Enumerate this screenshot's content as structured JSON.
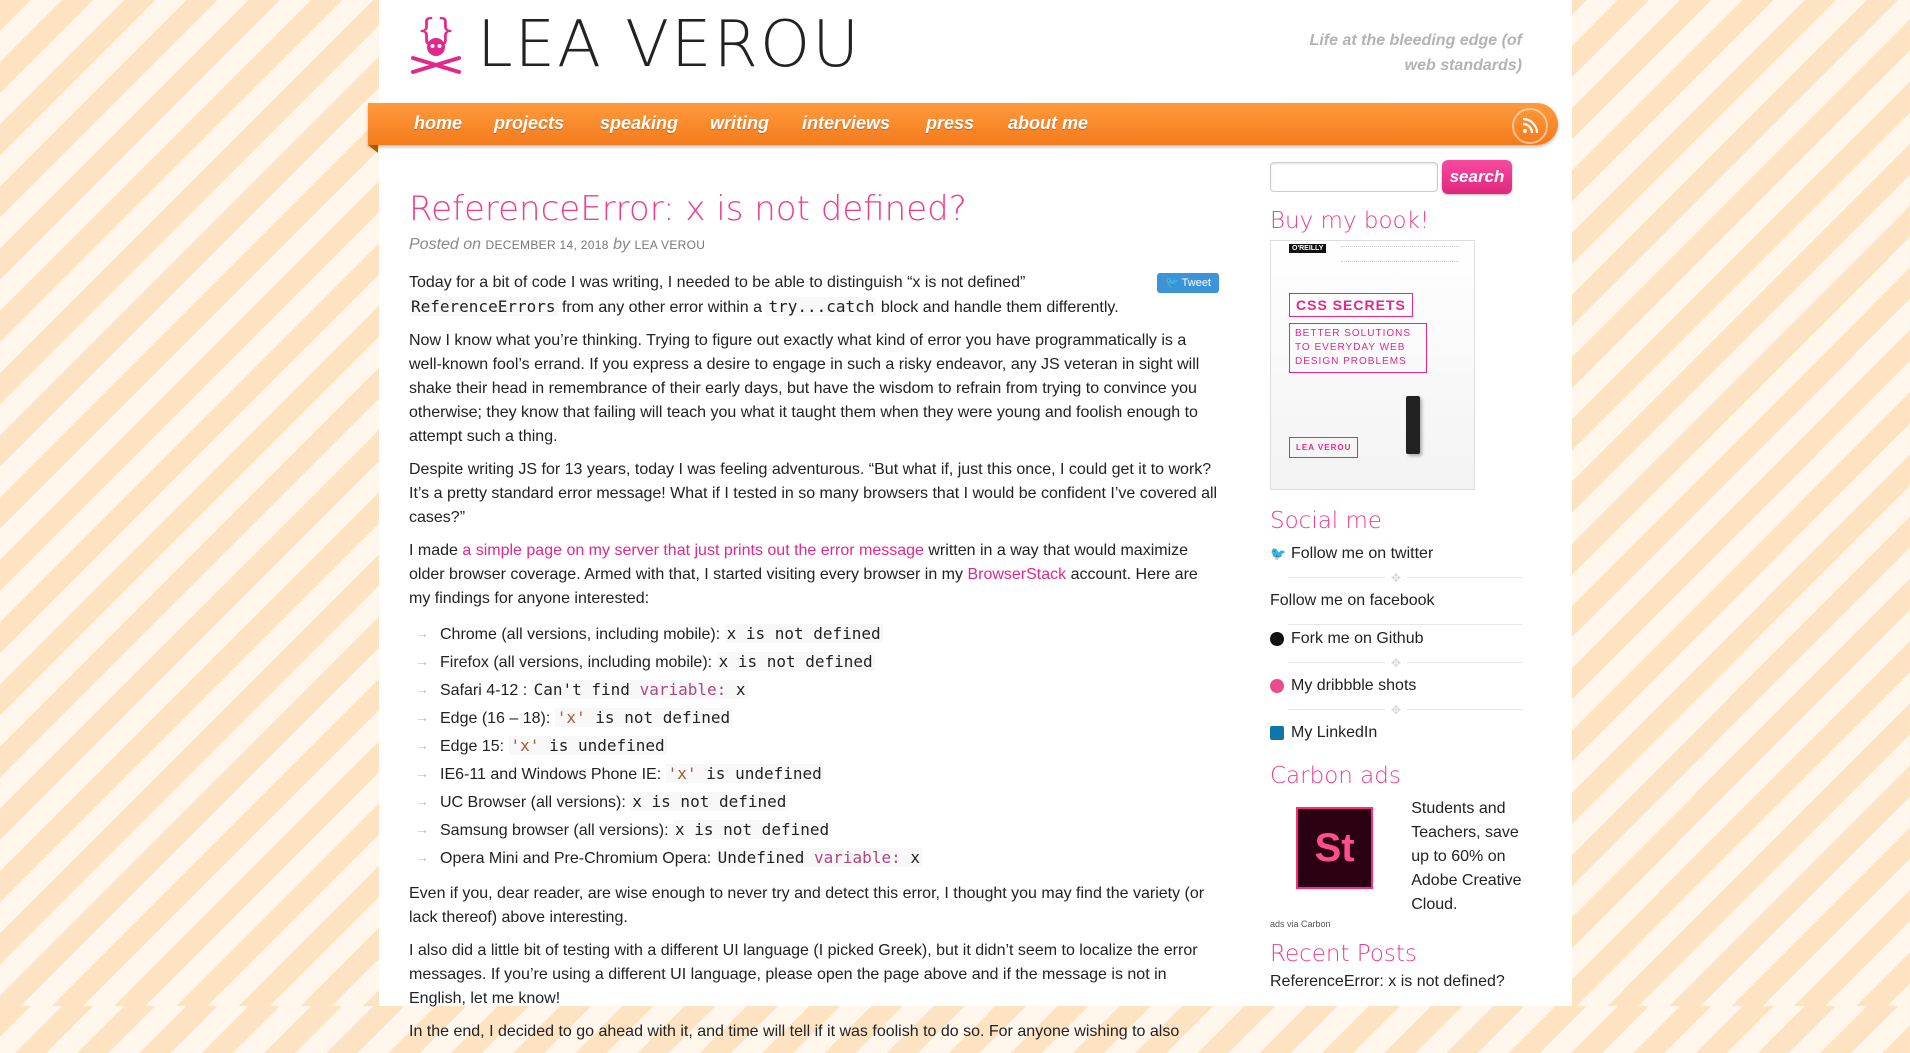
{
  "header": {
    "site_name": "LEA VEROU",
    "tagline": "Life at the bleeding edge (of web standards)"
  },
  "nav": {
    "items": [
      "home",
      "projects",
      "speaking",
      "writing",
      "interviews",
      "press",
      "about me"
    ]
  },
  "post": {
    "title": "ReferenceError: x is not defined?",
    "posted_on": "Posted on",
    "date": "December 14, 2018",
    "by": "by",
    "author": "Lea Verou",
    "tweet": "Tweet",
    "p1": {
      "a": "Today for a bit of code I was writing, I needed to be able to distinguish “x is not defined”",
      "code1": "ReferenceErrors",
      "b": "from any other error within a",
      "code2": "try...catch",
      "c": "block and handle them differently."
    },
    "p2": "Now I know what you’re thinking. Trying to figure out exactly what kind of error you have programmatically is a well-known fool’s errand. If you express a desire to engage in such a risky endeavor, any JS veteran in sight will shake their head in remembrance of their early days, but have the wisdom to refrain from trying to convince you otherwise; they know that failing will teach you what it taught them when they were young and foolish enough to attempt such a thing.",
    "p3": "Despite writing JS for 13 years, today I was feeling adventurous. “But what if, just this once, I could get it to work? It’s a pretty standard error message! What if I tested in so many browsers that I would be confident I’ve covered all cases?”",
    "p4": {
      "a": "I made",
      "link1": "a simple page on my server that just prints out the error message",
      "b": "written in a way that would maximize older browser coverage. Armed with that, I started visiting every browser in my",
      "link2": "BrowserStack",
      "c": "account. Here are my findings for anyone interested:"
    },
    "findings": [
      {
        "label": "Chrome (all versions, including mobile):",
        "code": "x is not defined"
      },
      {
        "label": "Firefox (all versions, including mobile):",
        "code": "x is not defined"
      },
      {
        "label": "Safari 4-12 :",
        "code_a": "Can't find",
        "code_kw": "variable:",
        "code_b": "x"
      },
      {
        "label": "Edge (16 – 18):",
        "code_str": "'x'",
        "code": "is not defined"
      },
      {
        "label": "Edge 15:",
        "code_str": "'x'",
        "code": "is undefined"
      },
      {
        "label": "IE6-11 and Windows Phone IE:",
        "code_str": "'x'",
        "code": "is undefined"
      },
      {
        "label": "UC Browser (all versions):",
        "code": "x is not defined"
      },
      {
        "label": "Samsung browser (all versions):",
        "code": "x is not defined"
      },
      {
        "label": "Opera Mini and Pre-Chromium Opera:",
        "code_a": "Undefined",
        "code_kw": "variable:",
        "code_b": "x"
      }
    ],
    "p5": "Even if you, dear reader, are wise enough to never try and detect this error, I thought you may find the variety (or lack thereof) above interesting.",
    "p6": "I also did a little bit of testing with a different UI language (I picked Greek), but it didn’t seem to localize the error messages. If you’re using a different UI language, please open the page above and if the message is not in English, let me know!",
    "p7": "In the end, I decided to go ahead with it, and time will tell if it was foolish to do so. For anyone wishing to also"
  },
  "sidebar": {
    "search_button": "search",
    "buy_heading": "Buy my book!",
    "book": {
      "publisher": "O'REILLY",
      "title": "CSS SECRETS",
      "subtitle": "BETTER SOLUTIONS TO EVERYDAY WEB DESIGN PROBLEMS",
      "author": "LEA VEROU"
    },
    "social_heading": "Social me",
    "social": [
      "Follow me on twitter",
      "Follow me on facebook",
      "Fork me on Github",
      "My dribbble shots",
      "My LinkedIn"
    ],
    "carbon_heading": "Carbon ads",
    "carbon_logo": "St",
    "carbon_text": "Students and Teachers, save up to 60% on Adobe Creative Cloud.",
    "carbon_via": "ads via Carbon",
    "recent_heading": "Recent Posts",
    "recent": [
      "ReferenceError: x is not defined?"
    ]
  },
  "colors": {
    "accent": "#ef3c8c",
    "nav": "#f47b1c",
    "stripe": "#fde3c2"
  }
}
